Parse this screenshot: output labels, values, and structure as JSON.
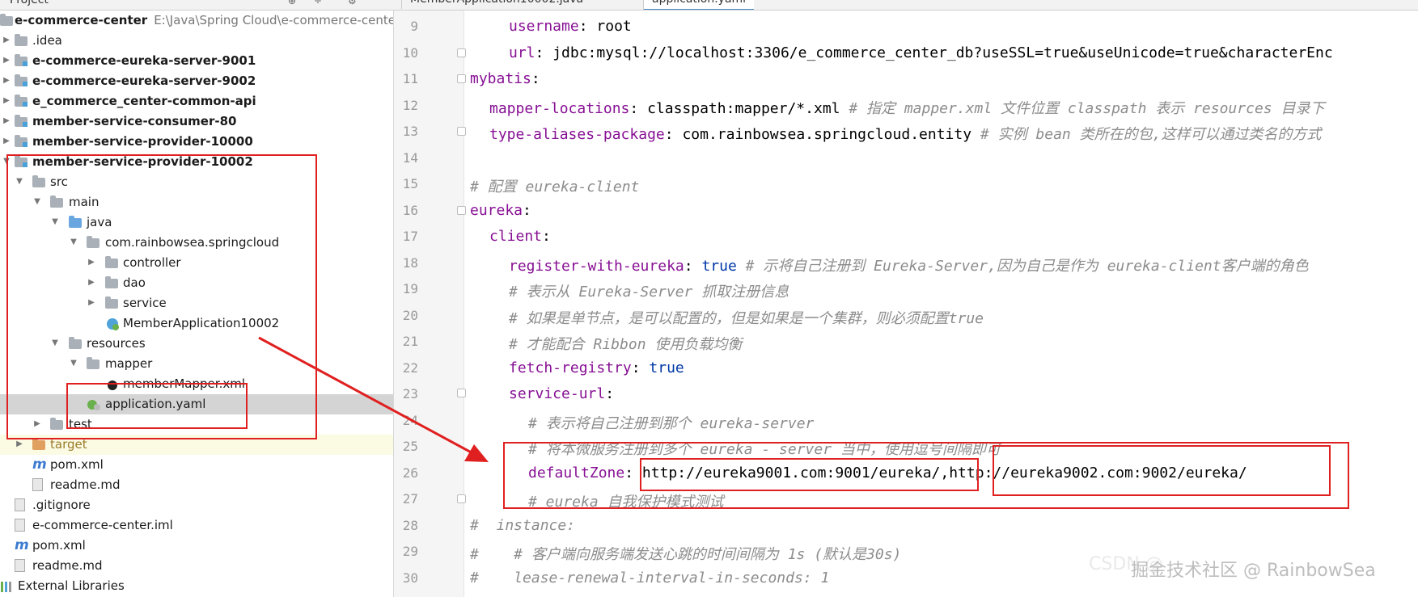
{
  "header": {
    "project_label": "Project",
    "tabs": [
      {
        "label": "MemberApplication10002.java",
        "active": false
      },
      {
        "label": "application.yaml",
        "active": true
      }
    ]
  },
  "tree": {
    "root": {
      "name": "e-commerce-center",
      "path": "E:\\Java\\Spring Cloud\\e-commerce-center"
    },
    "items": [
      {
        "label": "e-commerce-center"
      },
      {
        "label": ".idea"
      },
      {
        "label": "e-commerce-eureka-server-9001"
      },
      {
        "label": "e-commerce-eureka-server-9002"
      },
      {
        "label": "e_commerce_center-common-api"
      },
      {
        "label": "member-service-consumer-80"
      },
      {
        "label": "member-service-provider-10000"
      },
      {
        "label": "member-service-provider-10002"
      },
      {
        "label": "src"
      },
      {
        "label": "main"
      },
      {
        "label": "java"
      },
      {
        "label": "com.rainbowsea.springcloud"
      },
      {
        "label": "controller"
      },
      {
        "label": "dao"
      },
      {
        "label": "service"
      },
      {
        "label": "MemberApplication10002"
      },
      {
        "label": "resources"
      },
      {
        "label": "mapper"
      },
      {
        "label": "memberMapper.xml"
      },
      {
        "label": "application.yaml"
      },
      {
        "label": "test"
      },
      {
        "label": "target"
      },
      {
        "label": "pom.xml"
      },
      {
        "label": "readme.md"
      },
      {
        "label": ".gitignore"
      },
      {
        "label": "e-commerce-center.iml"
      },
      {
        "label": "pom.xml"
      },
      {
        "label": "readme.md"
      },
      {
        "label": "External Libraries"
      }
    ]
  },
  "editor": {
    "line_numbers": [
      "9",
      "10",
      "11",
      "12",
      "13",
      "14",
      "15",
      "16",
      "17",
      "18",
      "19",
      "20",
      "21",
      "22",
      "23",
      "24",
      "25",
      "26",
      "27",
      "28",
      "29",
      "30"
    ],
    "lines": {
      "l9": {
        "key": "username",
        "colon": ": ",
        "value": "root"
      },
      "l10": {
        "key": "url",
        "colon": ": ",
        "value": "jdbc:mysql://localhost:3306/e_commerce_center_db?useSSL=true&useUnicode=true&characterEnc"
      },
      "l11": {
        "key": "mybatis",
        "colon": ":"
      },
      "l12": {
        "key": "mapper-locations",
        "colon": ": ",
        "value": "classpath:mapper/*.xml ",
        "comment": "# 指定 mapper.xml 文件位置 classpath 表示 resources 目录下"
      },
      "l13": {
        "key": "type-aliases-package",
        "colon": ": ",
        "value": "com.rainbowsea.springcloud.entity ",
        "comment": "# 实例 bean 类所在的包,这样可以通过类名的方式"
      },
      "l14": {},
      "l15": {
        "comment": "# 配置 eureka-client"
      },
      "l16": {
        "key": "eureka",
        "colon": ":"
      },
      "l17": {
        "key": "client",
        "colon": ":"
      },
      "l18": {
        "key": "register-with-eureka",
        "colon": ": ",
        "value": "true",
        "comment": " # 示将自己注册到 Eureka-Server,因为自己是作为 eureka-client客户端的角色"
      },
      "l19": {
        "comment": "# 表示从 Eureka-Server 抓取注册信息"
      },
      "l20": {
        "comment": "# 如果是单节点，是可以配置的，但是如果是一个集群，则必须配置true"
      },
      "l21": {
        "comment": "# 才能配合 Ribbon 使用负载均衡"
      },
      "l22": {
        "key": "fetch-registry",
        "colon": ": ",
        "value": "true"
      },
      "l23": {
        "key": "service-url",
        "colon": ":"
      },
      "l24": {
        "comment": "# 表示将自己注册到那个 eureka-server"
      },
      "l25": {
        "comment": "# 将本微服务注册到多个 eureka - server 当中，使用逗号间隔即可"
      },
      "l26": {
        "key": "defaultZone",
        "colon": ": ",
        "value1": "http://eureka9001.com:9001/eureka/",
        "comma": ",",
        "value2": "http://eureka9002.com:9002/eureka/"
      },
      "l27": {
        "comment": "# eureka 自我保护模式测试"
      },
      "l28": {
        "comment": "#  instance:"
      },
      "l29": {
        "comment": "#    # 客户端向服务端发送心跳的时间间隔为 1s (默认是30s)"
      },
      "l30": {
        "comment": "#    lease-renewal-interval-in-seconds: 1"
      }
    }
  },
  "watermark": {
    "text": "掘金技术社区 @ RainbowSea",
    "faded": "CSDN @"
  },
  "colors": {
    "annotation": "#e02020",
    "yaml_key": "#871094",
    "comment": "#8c8c8c",
    "bool": "#0037a6",
    "selection": "#d4d4d4"
  }
}
